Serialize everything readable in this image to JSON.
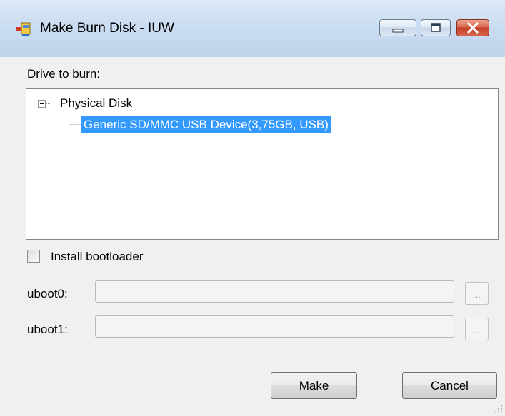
{
  "window": {
    "title": "Make Burn Disk - IUW",
    "icon": "app-window-icon",
    "controls": [
      "minimize",
      "maximize",
      "close"
    ]
  },
  "drive_label": "Drive to burn:",
  "tree": {
    "root": {
      "label": "Physical Disk",
      "expanded": true,
      "expander": "-"
    },
    "children": [
      {
        "label": "Generic SD/MMC USB Device(3,75GB, USB)",
        "selected": true
      }
    ]
  },
  "bootloader": {
    "label": "Install bootloader",
    "checked": false
  },
  "uboot_fields": [
    {
      "label": "uboot0:",
      "value": "",
      "browse_label": "...",
      "enabled": false
    },
    {
      "label": "uboot1:",
      "value": "",
      "browse_label": "...",
      "enabled": false
    }
  ],
  "buttons": {
    "make": "Make",
    "cancel": "Cancel"
  },
  "colors": {
    "selection": "#3399ff",
    "titlebar": "#c9dcf1",
    "close_button": "#c3412a"
  }
}
